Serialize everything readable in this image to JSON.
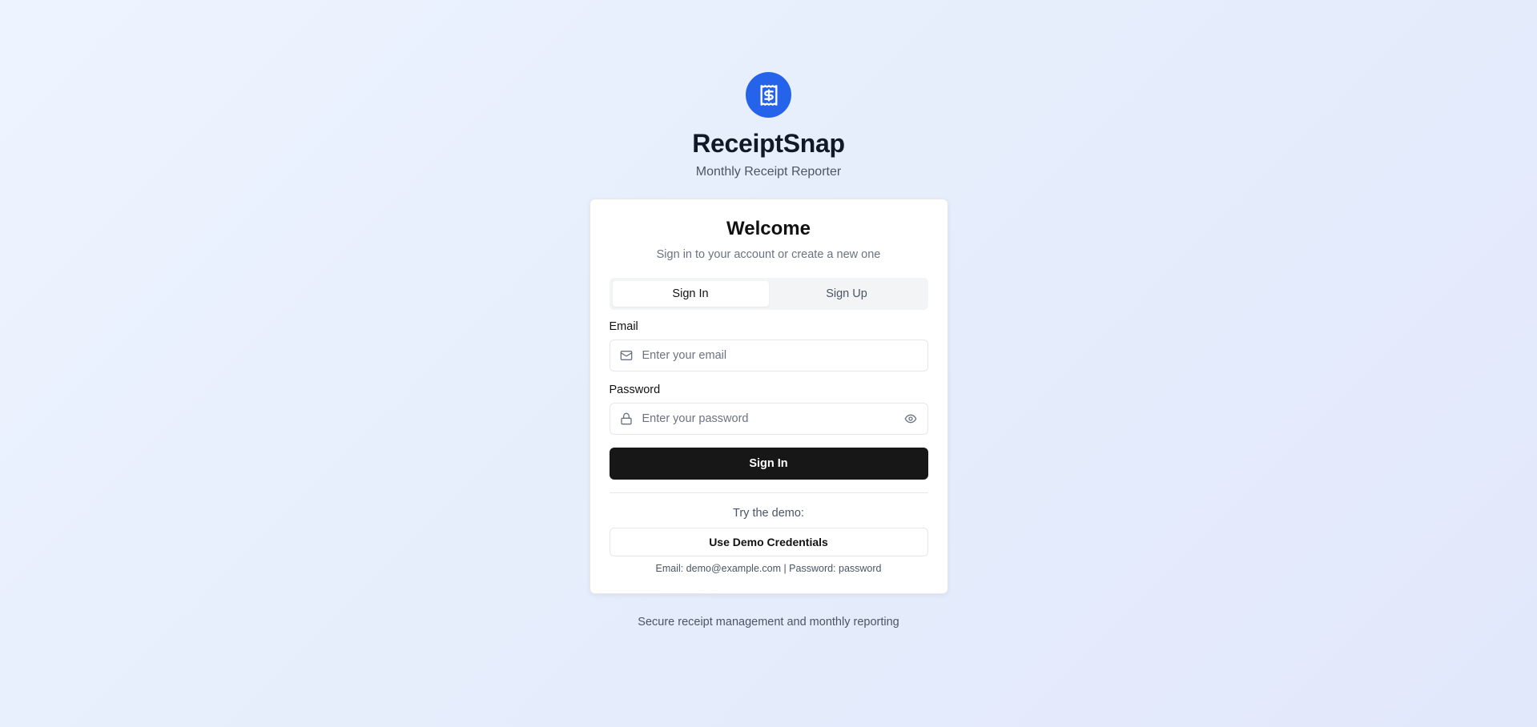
{
  "brand": {
    "name": "ReceiptSnap",
    "tagline": "Monthly Receipt Reporter",
    "logo_icon": "receipt-dollar-icon",
    "accent_color": "#2563eb"
  },
  "card": {
    "title": "Welcome",
    "description": "Sign in to your account or create a new one",
    "tabs": [
      {
        "label": "Sign In",
        "active": true
      },
      {
        "label": "Sign Up",
        "active": false
      }
    ],
    "email": {
      "label": "Email",
      "placeholder": "Enter your email",
      "value": "",
      "icon": "mail-icon"
    },
    "password": {
      "label": "Password",
      "placeholder": "Enter your password",
      "value": "",
      "icon": "lock-icon",
      "toggle_icon": "eye-icon"
    },
    "submit_label": "Sign In",
    "demo": {
      "hint": "Try the demo:",
      "button_label": "Use Demo Credentials",
      "credentials_text": "Email: demo@example.com | Password: password"
    }
  },
  "footer": {
    "note": "Secure receipt management and monthly reporting"
  }
}
